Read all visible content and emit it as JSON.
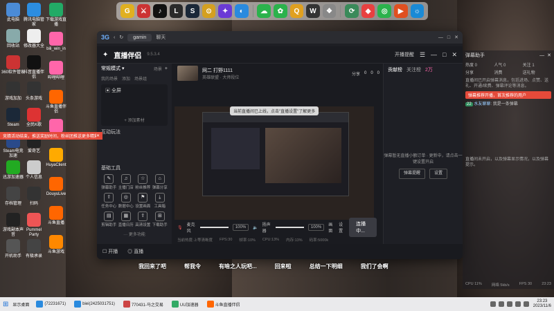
{
  "desktop": {
    "icons": [
      {
        "label": "此电脑",
        "color": "#4b8bd6"
      },
      {
        "label": "回收站",
        "color": "#8aa"
      },
      {
        "label": "360软件管家",
        "color": "#c33"
      },
      {
        "label": "游戏加加",
        "color": "#333"
      },
      {
        "label": "Steam",
        "color": "#1b2838"
      },
      {
        "label": "Steam电竞加速",
        "color": "#2a4a8a"
      },
      {
        "label": "迅游加速器",
        "color": "#2a2"
      },
      {
        "label": "存档管理",
        "color": "#444"
      },
      {
        "label": "游戏副本声音",
        "color": "#222"
      },
      {
        "label": "开机助手",
        "color": "#555"
      }
    ],
    "icons_col2": [
      {
        "label": "腾讯电脑管家",
        "color": "#2c8de0"
      },
      {
        "label": "修改器大全",
        "color": "#eee"
      },
      {
        "label": "抖音直播伴侣",
        "color": "#111"
      },
      {
        "label": "头条游戏",
        "color": "#333"
      },
      {
        "label": "全民K歌",
        "color": "#d33"
      },
      {
        "label": "爱奇艺",
        "color": "#222"
      },
      {
        "label": "个人信息",
        "color": "#ccc"
      },
      {
        "label": "扫码",
        "color": "#333"
      },
      {
        "label": "Pummel Party",
        "color": "#e55"
      },
      {
        "label": "有极承录",
        "color": "#444"
      }
    ],
    "icons_col3": [
      {
        "label": "下载游戏直播",
        "color": "#2a6"
      },
      {
        "label": "bili_win_in",
        "color": "#f6a"
      },
      {
        "label": "哔哩哔哩",
        "color": "#f6a"
      },
      {
        "label": "斗鱼直播伴侣",
        "color": "#f60"
      },
      {
        "label": "LiveHime",
        "color": "#f6a"
      },
      {
        "label": "HuyaClient",
        "color": "#fa0"
      },
      {
        "label": "DouyuLive",
        "color": "#f60"
      },
      {
        "label": "斗鱼直播",
        "color": "#f60"
      },
      {
        "label": "斗鱼游戏",
        "color": "#f80"
      }
    ]
  },
  "launcher": {
    "icons": [
      "G",
      "⚔",
      "♪",
      "L",
      "S",
      "⊙",
      "✦",
      "◐",
      "☁",
      "✿",
      "Q",
      "W",
      "❖",
      "⟳",
      "◆",
      "◎",
      "▶",
      "☼"
    ]
  },
  "browser": {
    "logo": "3G",
    "tab": "gamin",
    "tab2": "聊天",
    "controls": [
      "—",
      "□",
      "✕"
    ]
  },
  "app": {
    "title": "直播伴侣",
    "version": "9.5.3.4",
    "mode": "常规模式 ▾",
    "menu_right": [
      "开播提醒",
      "☰",
      "—",
      "□",
      "✕"
    ],
    "scene_header": [
      "场景",
      "+"
    ],
    "scene_tabs": [
      "我的场景",
      "添加",
      "场景组"
    ],
    "scene_item": "全屏",
    "add_source": "+ 添加素材",
    "interactive": "互动玩法",
    "alert": "竞猜活动结束，推送奖励时间，粉丝团推送更多精彩内容进行！",
    "tools_label": "基础工具",
    "tools": [
      {
        "icon": "✎",
        "label": "弹幕助手"
      },
      {
        "icon": "♫",
        "label": "主播门店"
      },
      {
        "icon": "☆",
        "label": "粉丝推荐"
      },
      {
        "icon": "⌂",
        "label": "弹幕分享"
      },
      {
        "icon": "⇧",
        "label": "任务中心"
      },
      {
        "icon": "◎",
        "label": "数据中心"
      },
      {
        "icon": "⚑",
        "label": "设置画面"
      },
      {
        "icon": "⤓",
        "label": "工具箱"
      },
      {
        "icon": "▤",
        "label": "剪辑助手"
      },
      {
        "icon": "▦",
        "label": "直播日历"
      },
      {
        "icon": "⇪",
        "label": "高清设置"
      },
      {
        "icon": "⊞",
        "label": "下载助手"
      }
    ],
    "more": "··· 更多功能",
    "stream_title": "网二 打野1111",
    "stream_sub": "英雄联盟 · 大师段位",
    "notice": "当前直播间已上线，点击\"直播设置\"了解更多",
    "stream_stats": [
      "分享",
      "0",
      "0",
      "0"
    ],
    "mic_label": "麦克风",
    "mic_pct": "100%",
    "speaker_label": "扬声器",
    "speaker_pct": "100%",
    "right_controls": [
      "画面",
      "设置"
    ],
    "go_live": "连播中...",
    "status": [
      "当前热度:上等清晰度",
      "FPS:30",
      "帧率:10%",
      "CPU:13%",
      "内存:13%",
      "码率:5000k"
    ],
    "bottom": [
      {
        "icon": "☐",
        "label": "开播"
      },
      {
        "icon": "◎",
        "label": "直播"
      }
    ],
    "right_tabs": [
      "贡献榜",
      "关注榜"
    ],
    "right_tab_active": "贡献榜",
    "right_count": "2万",
    "right_note": "弹幕暂无直播小额订单 · 更新中，请点击一键设置开启",
    "right_btns": [
      "弹幕提醒",
      "设置"
    ]
  },
  "chat": {
    "title": "弹幕助手",
    "controls": [
      "—",
      "✕"
    ],
    "stats": [
      "热度 0",
      "人气 0",
      "关注 1",
      "0",
      "0",
      "0"
    ],
    "stat_labels": [
      "分享",
      "消费",
      "送礼物"
    ],
    "intro": "直播间已开启弹幕消息，包括进场、点赞、送礼、开通/续费、弹幕评论等消息。",
    "red1": "弹幕推荐开播，首次推荐的用户",
    "user": "水友聊聊",
    "user_msg": "我是一条弹幕",
    "tip": "直播间未开启，以及弹幕显示情况，以及弹幕提示。",
    "footer": [
      "CPU 11%",
      "网络 5kb/s",
      "FPS 30",
      "23:23"
    ]
  },
  "subs": [
    "我回来了吧",
    "帮我令",
    "有啥之人玩吧...",
    "回来啦",
    "总结一下明细",
    "我们了会啊"
  ],
  "taskbar": {
    "start": "显示桌面",
    "items": [
      {
        "label": "(72231671)",
        "color": "#2a8ade"
      },
      {
        "label": "biei(2425031751)",
        "color": "#2a8ade"
      },
      {
        "label": "770431-马之交易",
        "color": "#c44"
      },
      {
        "label": "UU加速器",
        "color": "#3a6"
      },
      {
        "label": "斗鱼直播伴侣",
        "color": "#f60"
      }
    ],
    "time": "23:23",
    "date": "2023/11/6"
  }
}
